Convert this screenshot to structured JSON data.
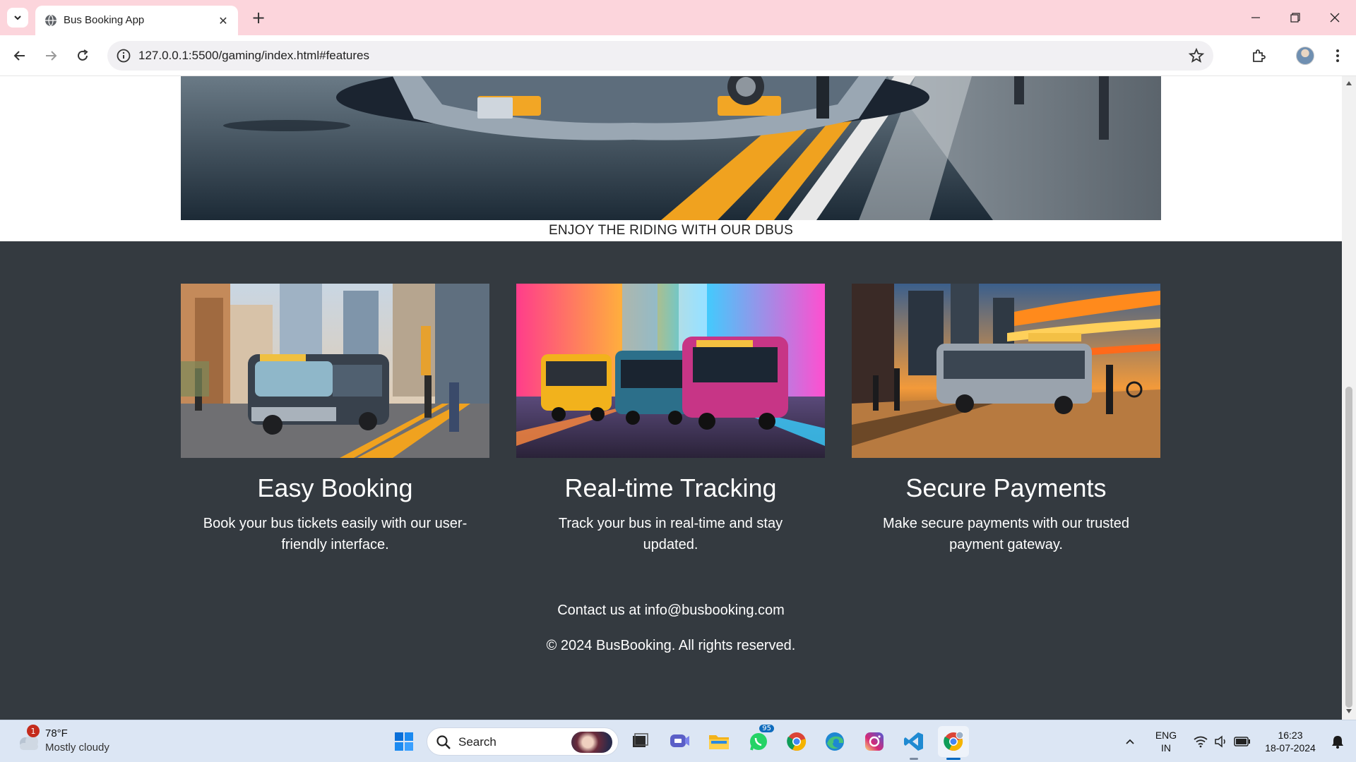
{
  "browser": {
    "tab_title": "Bus Booking App",
    "url": "127.0.0.1:5500/gaming/index.html#features"
  },
  "page": {
    "hero_caption": "ENJOY THE RIDING WITH OUR DBUS",
    "features": [
      {
        "title": "Easy Booking",
        "description": "Book your bus tickets easily with our user-friendly interface."
      },
      {
        "title": "Real-time Tracking",
        "description": "Track your bus in real-time and stay updated."
      },
      {
        "title": "Secure Payments",
        "description": "Make secure payments with our trusted payment gateway."
      }
    ],
    "footer": {
      "contact": "Contact us at info@busbooking.com",
      "copyright": "© 2024 BusBooking. All rights reserved."
    }
  },
  "taskbar": {
    "weather": {
      "temp": "78°F",
      "desc": "Mostly cloudy",
      "badge": "1"
    },
    "search_label": "Search",
    "whatsapp_badge": "95",
    "lang": "ENG",
    "region": "IN",
    "time": "16:23",
    "date": "18-07-2024"
  },
  "colors": {
    "tabbar_bg": "#fcd5dc",
    "features_bg": "#343a40",
    "taskbar_bg": "#dce6f4"
  }
}
